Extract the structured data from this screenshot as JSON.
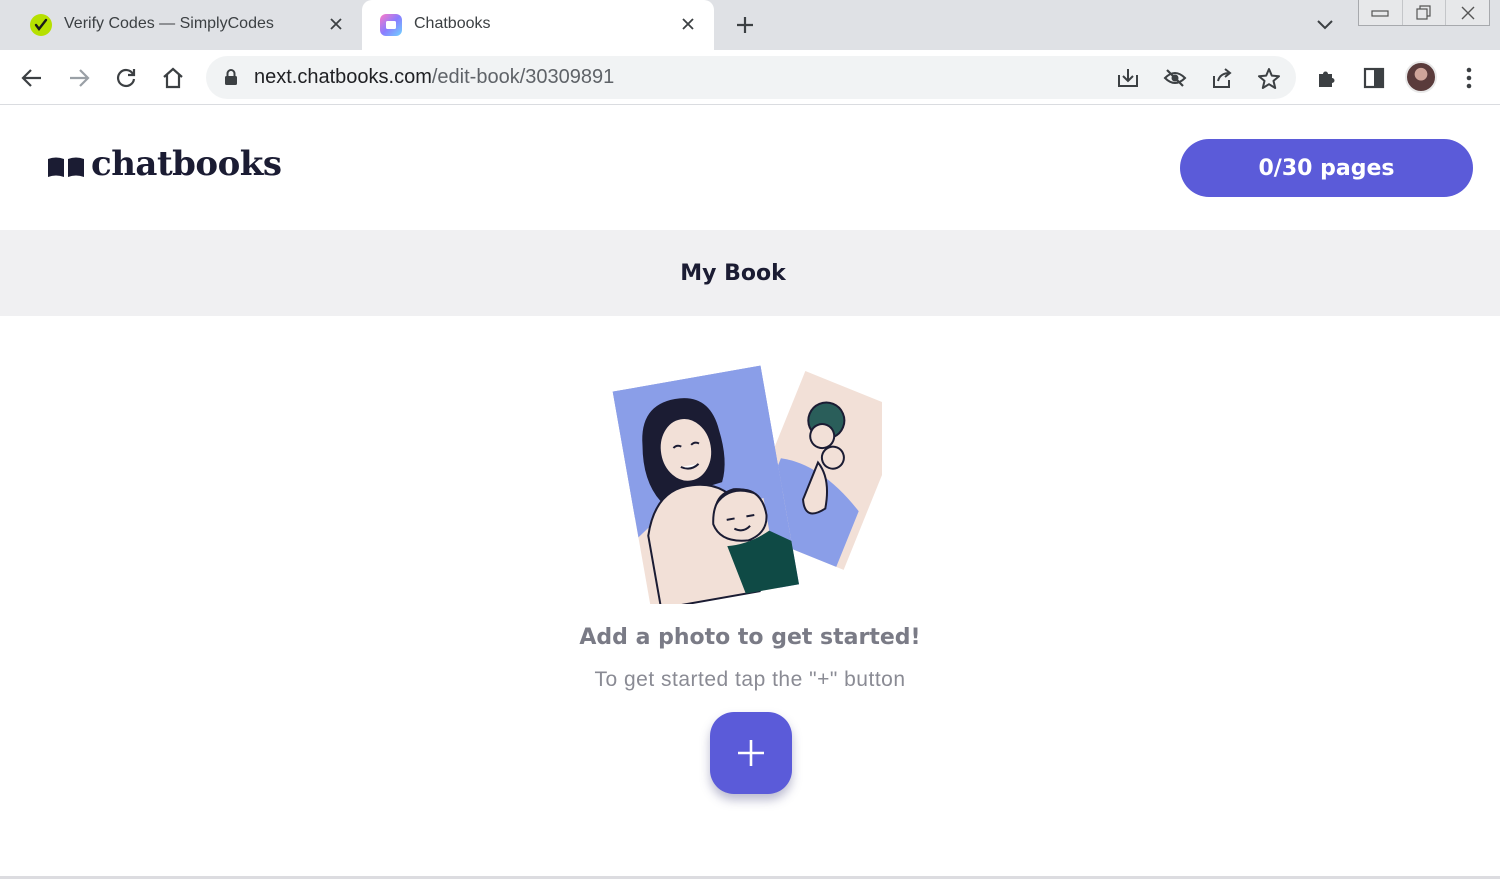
{
  "browser": {
    "tabs": [
      {
        "title": "Verify Codes — SimplyCodes",
        "active": false,
        "favicon": "simplycodes-favicon"
      },
      {
        "title": "Chatbooks",
        "active": true,
        "favicon": "chatbooks-favicon"
      }
    ],
    "url_host": "next.chatbooks.com",
    "url_path": "/edit-book/30309891"
  },
  "site": {
    "logo_text": "chatbooks",
    "pages_button_label": "0/30 pages",
    "brand_color": "#5b5bd9"
  },
  "book": {
    "title": "My Book"
  },
  "empty_state": {
    "headline": "Add a photo to get started!",
    "subline": "To get started tap the \"+\" button",
    "add_button_icon": "plus-icon"
  }
}
